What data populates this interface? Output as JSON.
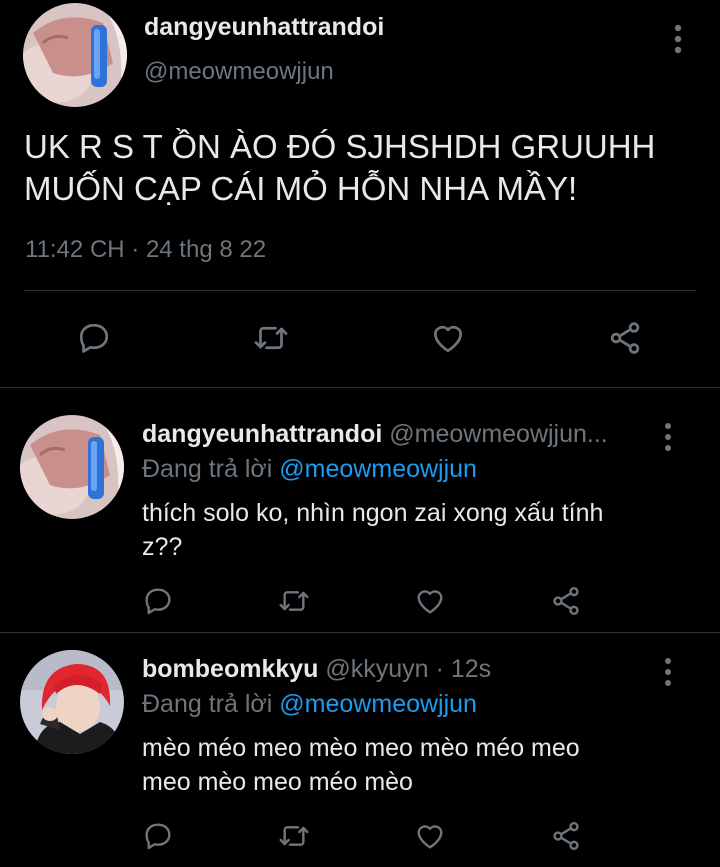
{
  "main_tweet": {
    "display_name": "dangyeunhattrandoi",
    "handle": "@meowmeowjjun",
    "text_lines": [
      "UK R S T ỒN ÀO ĐÓ SJHSHDH GRUUHH",
      "MUỐN CẠP CÁI MỎ HỖN NHA MẦY!"
    ],
    "timestamp": "11:42 CH · 24 thg 8 22",
    "actions": [
      "reply-icon",
      "retweet-icon",
      "like-icon",
      "share-icon"
    ]
  },
  "replies": [
    {
      "display_name": "dangyeunhattrandoi",
      "handle": "@meowmeowjjun...",
      "replying_to_prefix": "Đang trả lời",
      "replying_to": "@meowmeowjjun",
      "text_lines": [
        "thích solo ko, nhìn ngon zai xong xấu tính",
        "z??"
      ]
    },
    {
      "display_name": "bombeomkkyu",
      "handle": "@kkyuyn · 12s",
      "replying_to_prefix": "Đang trả lời",
      "replying_to": "@meowmeowjjun",
      "text_lines": [
        "mèo méo meo mèo meo mèo méo meo",
        "meo mèo meo méo mèo"
      ]
    }
  ],
  "colors": {
    "background": "#000000",
    "text": "#e7e9ea",
    "secondary": "#6e767d",
    "mention": "#1d9bf0",
    "divider": "#2f3336"
  }
}
